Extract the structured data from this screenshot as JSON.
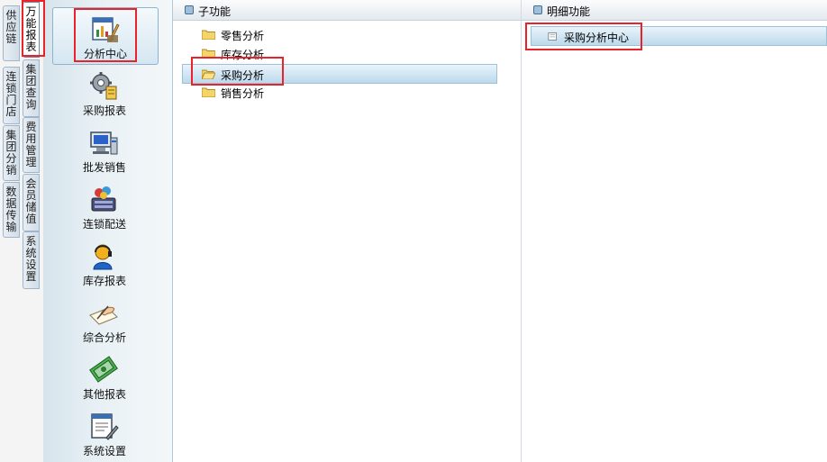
{
  "vertical_tabs": [
    {
      "label": "供应链"
    },
    {
      "label": "万能报表",
      "active": true
    },
    {
      "label": "集团查询"
    },
    {
      "label": "连锁门店"
    },
    {
      "label": "费用管理"
    },
    {
      "label": "集团分销"
    },
    {
      "label": "会员储值"
    },
    {
      "label": "数据传输"
    },
    {
      "label": "系统设置"
    }
  ],
  "icon_menu": [
    {
      "label": "分析中心",
      "icon": "analysis-chart-icon",
      "selected": true
    },
    {
      "label": "采购报表",
      "icon": "gear-report-icon"
    },
    {
      "label": "批发销售",
      "icon": "computer-terminal-icon"
    },
    {
      "label": "连锁配送",
      "icon": "cash-register-icon"
    },
    {
      "label": "库存报表",
      "icon": "user-headset-icon"
    },
    {
      "label": "综合分析",
      "icon": "hand-writing-icon"
    },
    {
      "label": "其他报表",
      "icon": "money-notes-icon"
    },
    {
      "label": "系统设置",
      "icon": "settings-document-icon"
    }
  ],
  "subfunction_panel": {
    "title": "子功能",
    "items": [
      {
        "label": "零售分析"
      },
      {
        "label": "库存分析"
      },
      {
        "label": "采购分析",
        "selected": true
      },
      {
        "label": "销售分析"
      }
    ]
  },
  "detail_panel": {
    "title": "明细功能",
    "items": [
      {
        "label": "采购分析中心",
        "selected": true
      }
    ]
  },
  "colors": {
    "highlight_border": "#e8232a",
    "selection": "#bcd9ec"
  }
}
